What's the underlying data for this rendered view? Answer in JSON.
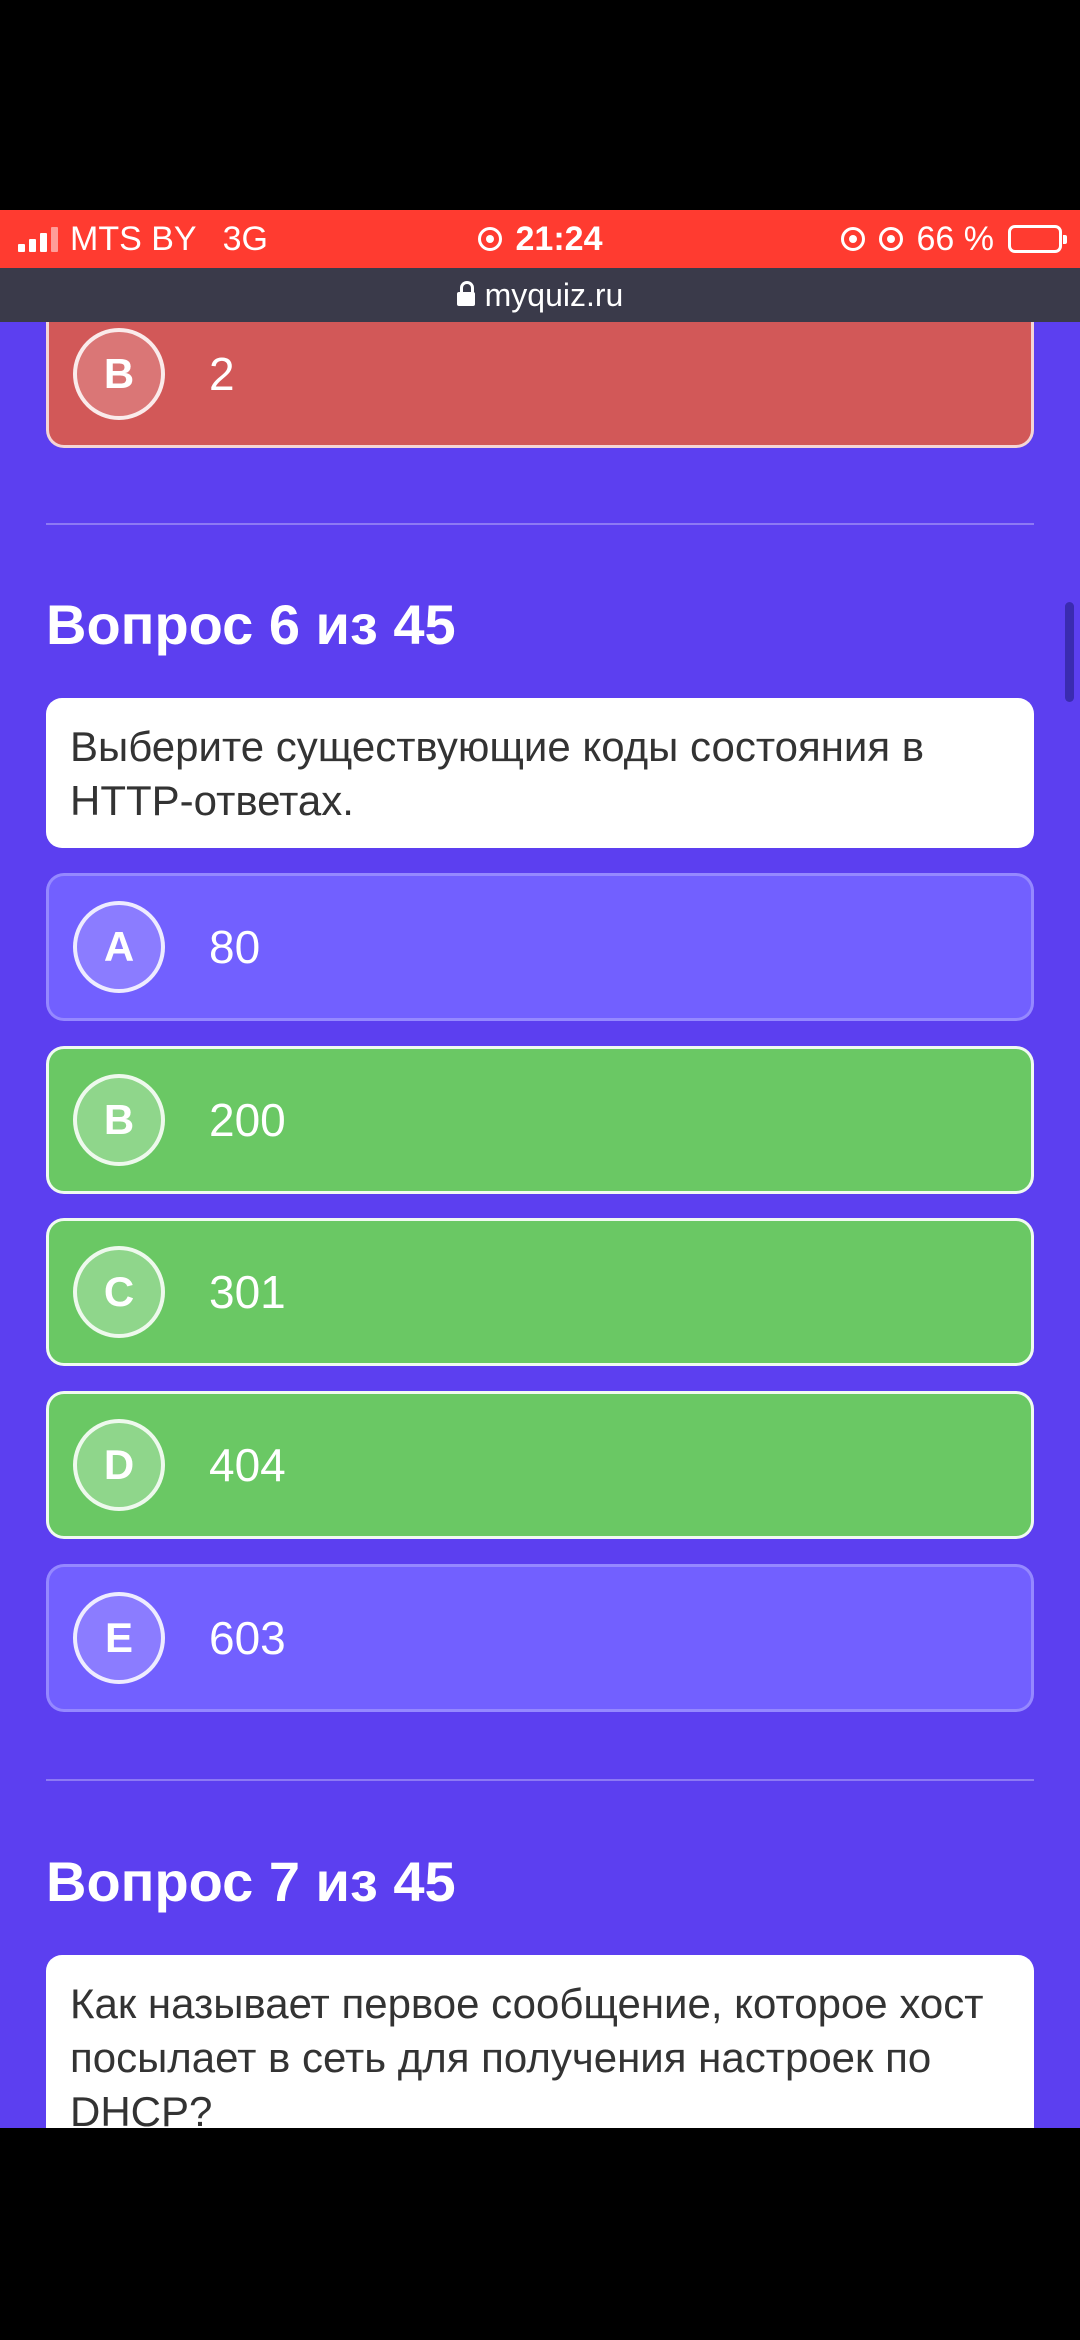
{
  "status_bar": {
    "carrier": "MTS BY",
    "network": "3G",
    "time": "21:24",
    "battery_percent": "66 %",
    "battery_level": 0.66
  },
  "browser": {
    "url": "myquiz.ru"
  },
  "prev_question": {
    "answer": {
      "letter": "B",
      "text": "2"
    }
  },
  "question6": {
    "title": "Вопрос 6 из 45",
    "text": "Выберите существующие коды состояния в HTTP-ответах.",
    "options": [
      {
        "letter": "A",
        "text": "80"
      },
      {
        "letter": "B",
        "text": "200"
      },
      {
        "letter": "C",
        "text": "301"
      },
      {
        "letter": "D",
        "text": "404"
      },
      {
        "letter": "E",
        "text": "603"
      }
    ]
  },
  "question7": {
    "title": "Вопрос 7 из 45",
    "text": "Как называет первое сообщение, которое хост посылает в сеть для получения настроек по DHCP?"
  },
  "colors": {
    "background": "#5c3ff0",
    "wrong": "#d25858",
    "correct": "#6ac864",
    "neutral": "#7260ff",
    "status_bar": "#ff3b30"
  }
}
